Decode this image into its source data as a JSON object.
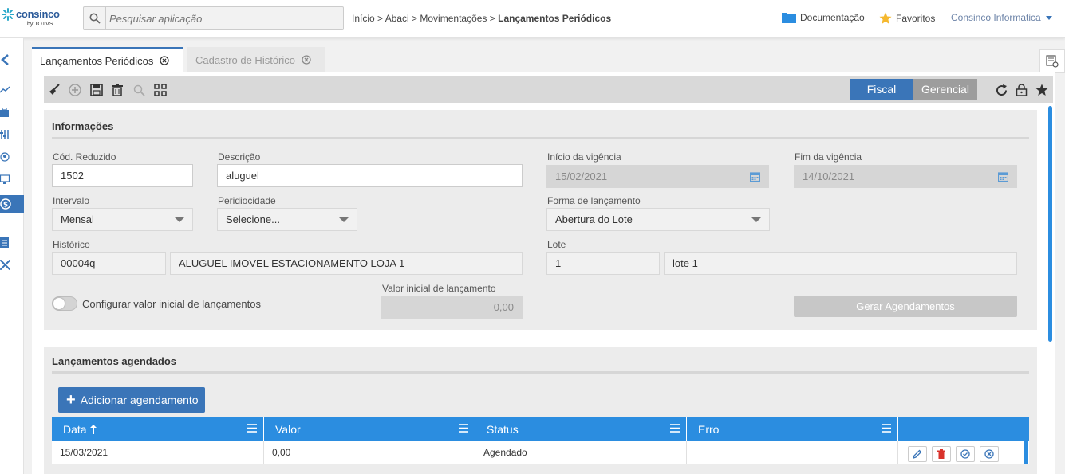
{
  "header": {
    "logo_brand": "consinco",
    "logo_sub": "by TOTVS",
    "search_placeholder": "Pesquisar aplicação",
    "breadcrumb_path": "Início > Abaci > Movimentações > ",
    "breadcrumb_current": "Lançamentos Periódicos",
    "documentation_label": "Documentação",
    "favorites_label": "Favoritos",
    "user_label": "Consinco Informatica",
    "accent_color": "#3a75b8"
  },
  "tabs": [
    {
      "label": "Lançamentos Periódicos"
    },
    {
      "label": "Cadastro de Histórico"
    }
  ],
  "toolbar": {
    "fiscal_label": "Fiscal",
    "gerencial_label": "Gerencial"
  },
  "informacoes": {
    "title": "Informações",
    "cod_reduzido": {
      "label": "Cód. Reduzido",
      "value": "1502"
    },
    "descricao": {
      "label": "Descrição",
      "value": "aluguel"
    },
    "inicio_vigencia": {
      "label": "Início da vigência",
      "value": "15/02/2021"
    },
    "fim_vigencia": {
      "label": "Fim da vigência",
      "value": "14/10/2021"
    },
    "intervalo": {
      "label": "Intervalo",
      "value": "Mensal"
    },
    "peridiocidade": {
      "label": "Peridiocidade",
      "value": "Selecione..."
    },
    "forma_lancamento": {
      "label": "Forma de lançamento",
      "value": "Abertura do Lote"
    },
    "historico": {
      "label": "Histórico",
      "code": "00004q",
      "description": "ALUGUEL IMOVEL ESTACIONAMENTO LOJA 1"
    },
    "lote": {
      "label": "Lote",
      "code": "1",
      "description": "lote 1"
    },
    "config_valor_label": "Configurar valor inicial de lançamentos",
    "valor_inicial": {
      "label": "Valor inicial de lançamento",
      "value": "0,00"
    },
    "gerar_label": "Gerar Agendamentos"
  },
  "agendados": {
    "title": "Lançamentos agendados",
    "add_label": "Adicionar agendamento",
    "columns": [
      "Data",
      "Valor",
      "Status",
      "Erro"
    ],
    "rows": [
      {
        "data": "15/03/2021",
        "valor": "0,00",
        "status": "Agendado",
        "erro": ""
      }
    ]
  }
}
